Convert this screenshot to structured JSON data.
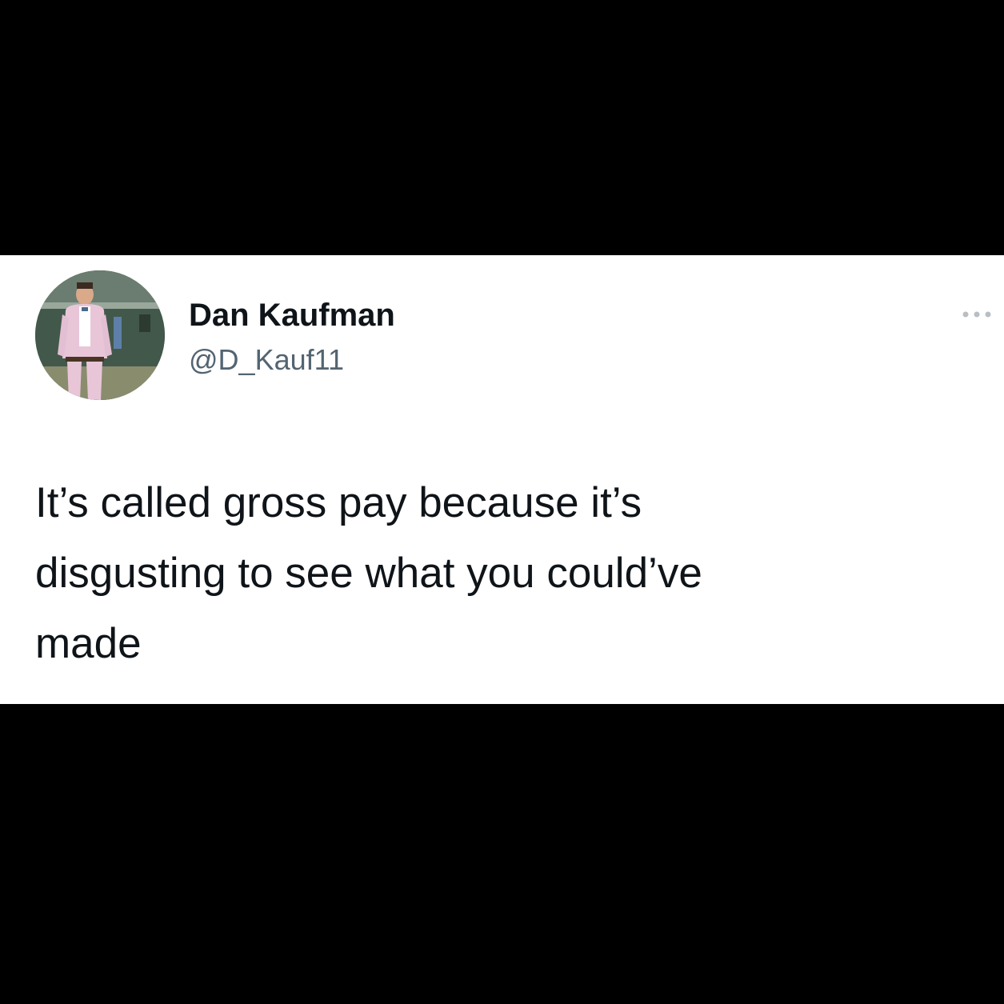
{
  "tweet": {
    "author": {
      "display_name": "Dan Kaufman",
      "handle": "@D_Kauf11",
      "avatar_icon": "profile-photo"
    },
    "more_icon": "more-horizontal-icon",
    "text_lines": [
      "It’s called gross pay because it’s",
      "disgusting to see what you could’ve",
      "made"
    ]
  },
  "colors": {
    "background": "#000000",
    "card": "#ffffff",
    "text_primary": "#0f1419",
    "text_secondary": "#536471"
  }
}
